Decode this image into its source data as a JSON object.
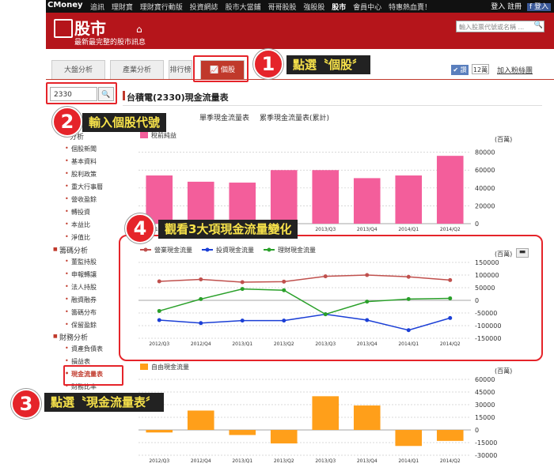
{
  "topbar": {
    "logo": "CMoney",
    "links": [
      "追訊",
      "理財寶",
      "理財寶行動版",
      "投資網誌",
      "股市大當鋪",
      "哥哥股股",
      "強股股",
      "股市",
      "會員中心",
      "特惠熱血賣！"
    ],
    "login": "登入",
    "register": "註冊",
    "fb": "f 登入"
  },
  "header": {
    "brand": "股市",
    "subtitle": "最新最完整的股市訊息",
    "search_placeholder": "輸入股票代號或名稱 ..."
  },
  "tabs": [
    {
      "label": "大盤分析"
    },
    {
      "label": "產業分析"
    },
    {
      "label": "排行榜"
    },
    {
      "label": "📈 個股"
    }
  ],
  "social": {
    "like": "✔ 讚",
    "count": "12萬",
    "follow": "加入粉絲團"
  },
  "stock_input": {
    "value": "2330"
  },
  "page_title": "台積電(2330)現金流量表",
  "subtabs": [
    "單季(現金流量表)",
    "單季現金流量表",
    "累季現金流量表(累計)"
  ],
  "sidebar": {
    "sections": [
      {
        "title": "分析",
        "items": [
          "個股新聞",
          "基本資料",
          "股利政策",
          "重大行事曆",
          "營收盈餘",
          "轉投資",
          "本益比",
          "淨值比"
        ]
      },
      {
        "title": "籌碼分析",
        "items": [
          "董監持股",
          "申報轉讓",
          "法人持股",
          "融資融券",
          "籌碼分布",
          "保留盈餘"
        ]
      },
      {
        "title": "財務分析",
        "items": [
          "資產負債表",
          "損益表",
          "現金流量表",
          "財務比率"
        ]
      }
    ],
    "active": "現金流量表"
  },
  "callouts": [
    {
      "num": "1",
      "text": "點選〝個股〞"
    },
    {
      "num": "2",
      "text": "輸入個股代號"
    },
    {
      "num": "3",
      "text": "點選〝現金流量表〞"
    },
    {
      "num": "4",
      "text": "觀看3大項現金流量變化"
    }
  ],
  "colors": {
    "brand": "#b5151b",
    "callout": "#e5242a",
    "callout_text": "#f7e24a",
    "bar_pink": "#f35e9b",
    "bar_orange": "#ff9f1a",
    "op": "#c0504d",
    "inv": "#1b3fd6",
    "fin": "#2aa02a"
  },
  "chart_data": [
    {
      "type": "bar",
      "title": "",
      "unit": "(百萬)",
      "categories": [
        "2012/Q3",
        "2012/Q4",
        "2013/Q1",
        "2013/Q2",
        "2013/Q3",
        "2013/Q4",
        "2014/Q1",
        "2014/Q2"
      ],
      "series": [
        {
          "name": "稅前純益",
          "values": [
            54000,
            47000,
            46000,
            60000,
            60000,
            51000,
            54000,
            76000
          ]
        }
      ],
      "y_ticks": [
        "80000",
        "60000",
        "40000",
        "20000",
        "0"
      ],
      "ylim": [
        0,
        85000
      ]
    },
    {
      "type": "line",
      "title": "",
      "unit": "(百萬)",
      "categories": [
        "2012/Q3",
        "2012/Q4",
        "2013/Q1",
        "2013/Q2",
        "2013/Q3",
        "2013/Q4",
        "2014/Q1",
        "2014/Q2"
      ],
      "series": [
        {
          "name": "營業現金流量",
          "values": [
            75000,
            83000,
            72000,
            74000,
            95000,
            100000,
            93000,
            80000
          ]
        },
        {
          "name": "投資現金流量",
          "values": [
            -78000,
            -90000,
            -80000,
            -80000,
            -55000,
            -78000,
            -118000,
            -70000
          ]
        },
        {
          "name": "理財現金流量",
          "values": [
            -42000,
            5000,
            45000,
            40000,
            -55000,
            -5000,
            5000,
            8000
          ]
        }
      ],
      "y_ticks": [
        "150000",
        "100000",
        "50000",
        "0",
        "-50000",
        "-100000",
        "-150000"
      ],
      "ylim": [
        -150000,
        150000
      ]
    },
    {
      "type": "bar",
      "title": "",
      "unit": "(百萬)",
      "categories": [
        "2012/Q3",
        "2012/Q4",
        "2013/Q1",
        "2013/Q2",
        "2013/Q3",
        "2013/Q4",
        "2014/Q1",
        "2014/Q2"
      ],
      "series": [
        {
          "name": "自由現金流量",
          "values": [
            -3000,
            23000,
            -6000,
            -16000,
            40000,
            29000,
            -19000,
            -13000
          ]
        }
      ],
      "y_ticks": [
        "60000",
        "45000",
        "30000",
        "15000",
        "0",
        "-15000",
        "-30000"
      ],
      "ylim": [
        -30000,
        60000
      ]
    }
  ]
}
